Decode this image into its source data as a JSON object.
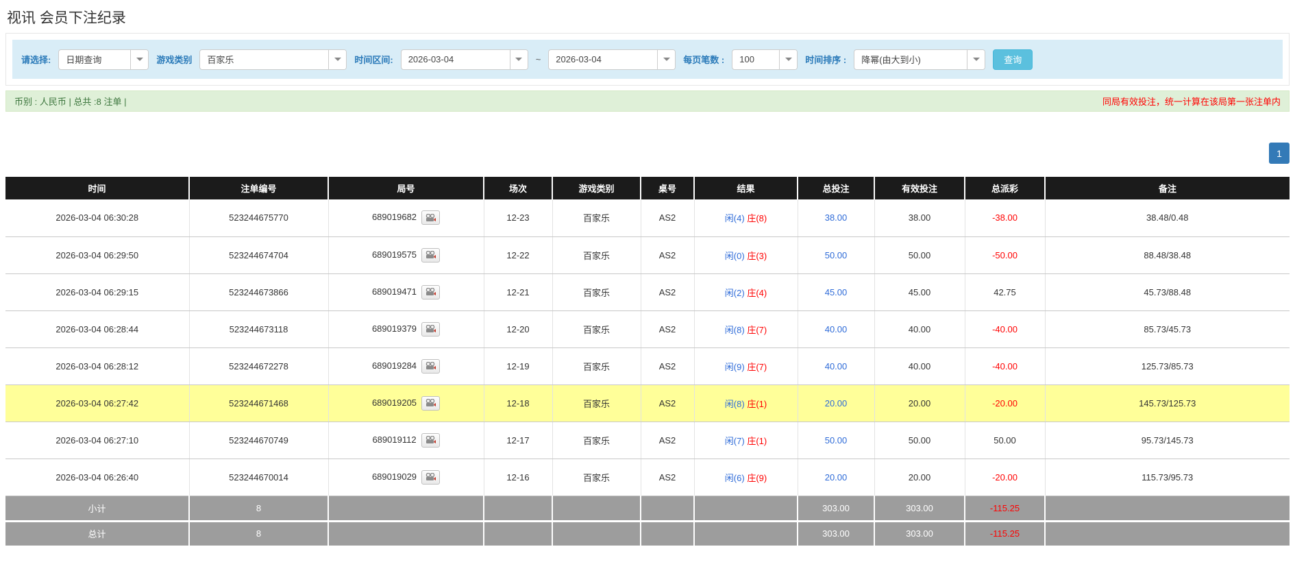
{
  "page": {
    "title": "视讯 会员下注纪录"
  },
  "filters": {
    "select_label": "请选择:",
    "select_value": "日期查询",
    "game_label": "游戏类别",
    "game_value": "百家乐",
    "range_label": "时间区间:",
    "range_start": "2026-03-04",
    "range_tilde": "~",
    "range_end": "2026-03-04",
    "page_size_label": "每页笔数 :",
    "page_size_value": "100",
    "sort_label": "时间排序 :",
    "sort_value": "降幂(由大到小)",
    "query_button": "查询"
  },
  "summary": {
    "left_text": "币别 : 人民币 | 总共 :8 注单 |",
    "right_text": "同局有效投注，统一计算在该局第一张注单内"
  },
  "pagination": {
    "current": "1"
  },
  "colors": {
    "accent_blue": "#2e6bd8",
    "negative_red": "#ff0000",
    "highlight_yellow": "#ffff99",
    "header_black": "#1b1b1b",
    "footer_gray": "#9d9d9d",
    "info_bar_blue": "#d9edf7",
    "summary_green": "#dff0d8",
    "query_button_blue": "#5bc0de",
    "pagination_blue": "#337ab7"
  },
  "table": {
    "headers": [
      "时间",
      "注单编号",
      "局号",
      "场次",
      "游戏类别",
      "桌号",
      "结果",
      "总投注",
      "有效投注",
      "总派彩",
      "备注"
    ],
    "rows": [
      {
        "time": "2026-03-04 06:30:28",
        "bet_id": "523244675770",
        "round_id": "689019682",
        "session": "12-23",
        "game": "百家乐",
        "table_no": "AS2",
        "result_player": "闲(4)",
        "result_banker": "庄(8)",
        "total_bet": "38.00",
        "valid_bet": "38.00",
        "payout": "-38.00",
        "remark": "38.48/0.48",
        "highlighted": false
      },
      {
        "time": "2026-03-04 06:29:50",
        "bet_id": "523244674704",
        "round_id": "689019575",
        "session": "12-22",
        "game": "百家乐",
        "table_no": "AS2",
        "result_player": "闲(0)",
        "result_banker": "庄(3)",
        "total_bet": "50.00",
        "valid_bet": "50.00",
        "payout": "-50.00",
        "remark": "88.48/38.48",
        "highlighted": false
      },
      {
        "time": "2026-03-04 06:29:15",
        "bet_id": "523244673866",
        "round_id": "689019471",
        "session": "12-21",
        "game": "百家乐",
        "table_no": "AS2",
        "result_player": "闲(2)",
        "result_banker": "庄(4)",
        "total_bet": "45.00",
        "valid_bet": "45.00",
        "payout": "42.75",
        "remark": "45.73/88.48",
        "highlighted": false
      },
      {
        "time": "2026-03-04 06:28:44",
        "bet_id": "523244673118",
        "round_id": "689019379",
        "session": "12-20",
        "game": "百家乐",
        "table_no": "AS2",
        "result_player": "闲(8)",
        "result_banker": "庄(7)",
        "total_bet": "40.00",
        "valid_bet": "40.00",
        "payout": "-40.00",
        "remark": "85.73/45.73",
        "highlighted": false
      },
      {
        "time": "2026-03-04 06:28:12",
        "bet_id": "523244672278",
        "round_id": "689019284",
        "session": "12-19",
        "game": "百家乐",
        "table_no": "AS2",
        "result_player": "闲(9)",
        "result_banker": "庄(7)",
        "total_bet": "40.00",
        "valid_bet": "40.00",
        "payout": "-40.00",
        "remark": "125.73/85.73",
        "highlighted": false
      },
      {
        "time": "2026-03-04 06:27:42",
        "bet_id": "523244671468",
        "round_id": "689019205",
        "session": "12-18",
        "game": "百家乐",
        "table_no": "AS2",
        "result_player": "闲(8)",
        "result_banker": "庄(1)",
        "total_bet": "20.00",
        "valid_bet": "20.00",
        "payout": "-20.00",
        "remark": "145.73/125.73",
        "highlighted": true
      },
      {
        "time": "2026-03-04 06:27:10",
        "bet_id": "523244670749",
        "round_id": "689019112",
        "session": "12-17",
        "game": "百家乐",
        "table_no": "AS2",
        "result_player": "闲(7)",
        "result_banker": "庄(1)",
        "total_bet": "50.00",
        "valid_bet": "50.00",
        "payout": "50.00",
        "remark": "95.73/145.73",
        "highlighted": false
      },
      {
        "time": "2026-03-04 06:26:40",
        "bet_id": "523244670014",
        "round_id": "689019029",
        "session": "12-16",
        "game": "百家乐",
        "table_no": "AS2",
        "result_player": "闲(6)",
        "result_banker": "庄(9)",
        "total_bet": "20.00",
        "valid_bet": "20.00",
        "payout": "-20.00",
        "remark": "115.73/95.73",
        "highlighted": false
      }
    ],
    "footers": [
      {
        "label": "小计",
        "count": "8",
        "total_bet": "303.00",
        "valid_bet": "303.00",
        "payout": "-115.25"
      },
      {
        "label": "总计",
        "count": "8",
        "total_bet": "303.00",
        "valid_bet": "303.00",
        "payout": "-115.25"
      }
    ]
  }
}
